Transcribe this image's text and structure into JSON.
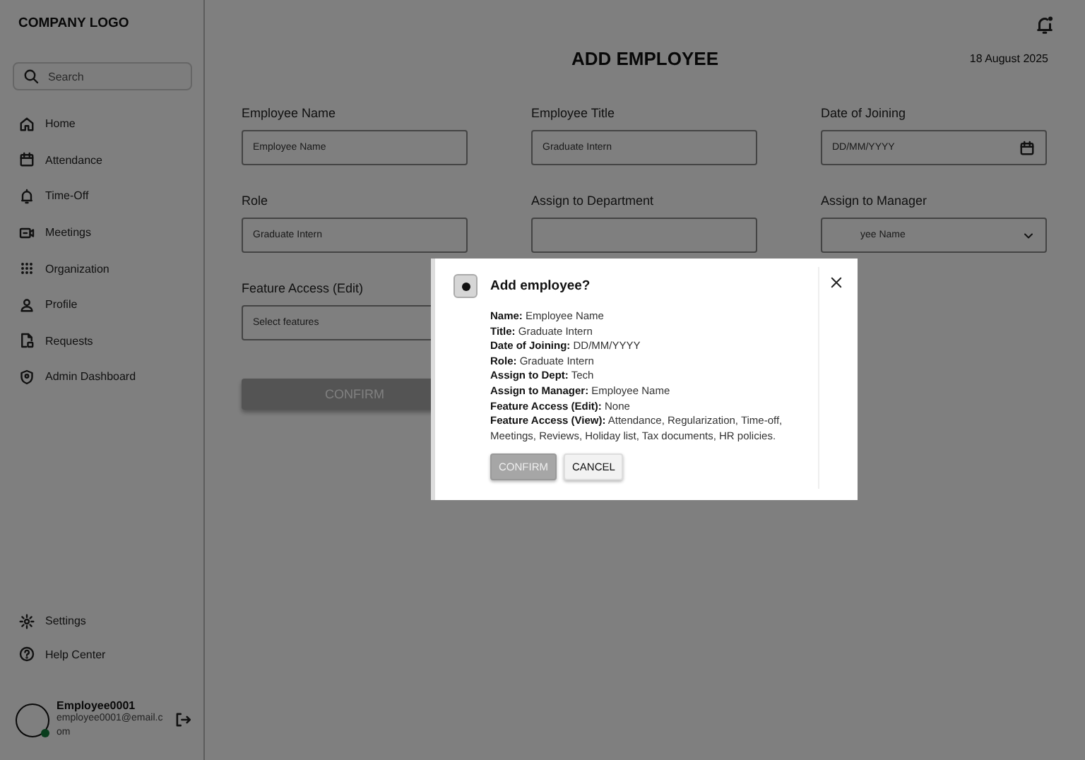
{
  "sidebar": {
    "logo": "COMPANY LOGO",
    "search": {
      "placeholder": "Search"
    },
    "items": [
      {
        "label": "Home"
      },
      {
        "label": "Attendance"
      },
      {
        "label": "Time-Off"
      },
      {
        "label": "Meetings"
      },
      {
        "label": "Organization"
      },
      {
        "label": "Profile"
      },
      {
        "label": "Requests"
      },
      {
        "label": "Admin Dashboard"
      }
    ],
    "bottom_items": [
      {
        "label": "Settings"
      },
      {
        "label": "Help Center"
      }
    ],
    "user": {
      "name": "Employee0001",
      "email": "employee0001@email.com",
      "online": true
    }
  },
  "header": {
    "title": "ADD EMPLOYEE",
    "date": "18 August 2025"
  },
  "form": {
    "fields": [
      {
        "label": "Employee Name",
        "placeholder": "Employee Name",
        "kind": "text"
      },
      {
        "label": "Employee Title",
        "placeholder": "Graduate Intern",
        "kind": "text"
      },
      {
        "label": "Date of Joining",
        "placeholder": "DD/MM/YYYY",
        "kind": "date"
      },
      {
        "label": "Role",
        "placeholder": "Graduate Intern",
        "kind": "text"
      },
      {
        "label": "Assign to Department",
        "kind": "text"
      },
      {
        "label": "Assign to Manager",
        "placeholder": "yee Name",
        "kind": "dropdown"
      },
      {
        "label": "Feature Access (Edit)",
        "placeholder": "Select features",
        "kind": "text"
      }
    ],
    "confirm": "CONFIRM"
  },
  "dialog": {
    "title": "Add employee?",
    "lines": [
      "**Name:** Employee Name",
      "**Title:** Graduate Intern",
      "**Date of Joining:** DD/MM/YYYY",
      "**Role:** Graduate Intern",
      "**Assign to Dept:** Tech",
      "**Assign to Manager:** Employee Name",
      "**Feature Access (Edit):** None",
      "**Feature Access (View):** Attendance, Regularization, Time-off, Meetings, Reviews, Holiday list, Tax documents, HR policies."
    ],
    "buttons": [
      {
        "label": "CONFIRM",
        "disabled": true
      },
      {
        "label": "CANCEL",
        "disabled": false
      }
    ]
  }
}
